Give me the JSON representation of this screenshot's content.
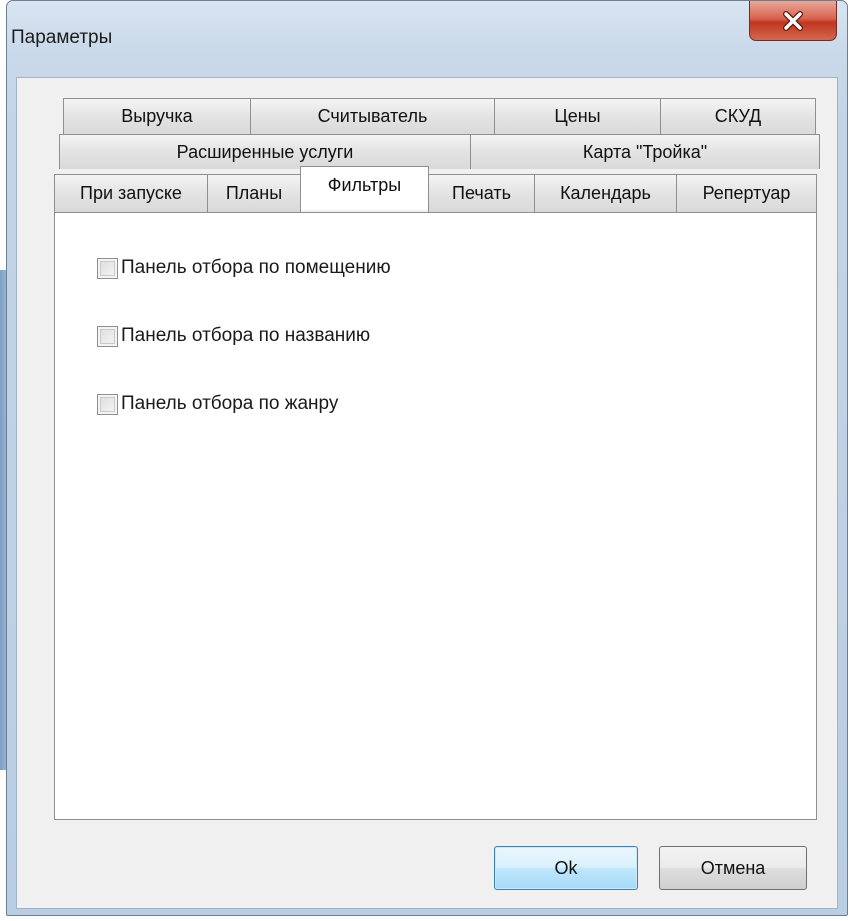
{
  "window": {
    "title": "Параметры"
  },
  "tabs": {
    "row1": [
      "Выручка",
      "Считыватель",
      "Цены",
      "СКУД"
    ],
    "row2": [
      "Расширенные услуги",
      "Карта \"Тройка\""
    ],
    "row3": [
      "При запуске",
      "Планы",
      "Фильтры",
      "Печать",
      "Календарь",
      "Репертуар"
    ],
    "active": "Фильтры"
  },
  "filters": {
    "room_panel": {
      "label": "Панель отбора по помещению",
      "checked": false
    },
    "name_panel": {
      "label": "Панель отбора по названию",
      "checked": false
    },
    "genre_panel": {
      "label": "Панель отбора по жанру",
      "checked": false
    }
  },
  "buttons": {
    "ok": "Ok",
    "cancel": "Отмена"
  }
}
